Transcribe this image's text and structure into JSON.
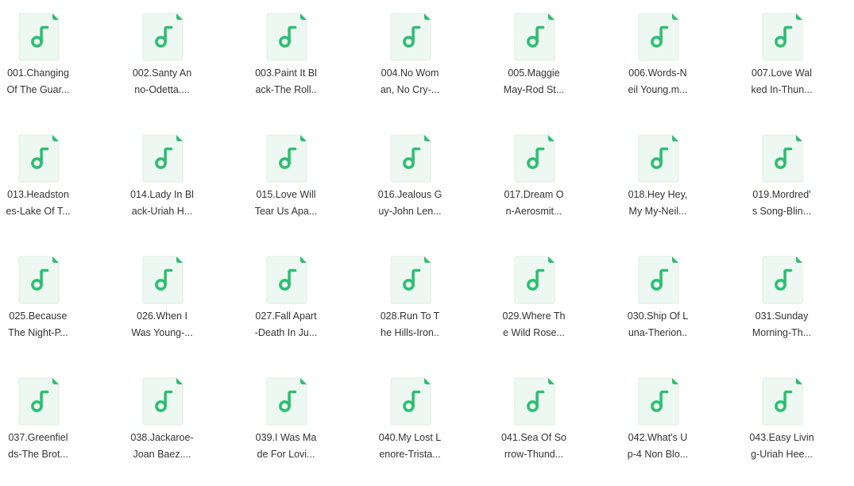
{
  "icons": {
    "file": "music-file-icon",
    "accent": "#2ebf72",
    "paper": "#eef8f2",
    "edge": "#dcece2"
  },
  "files": [
    {
      "line1": "001.Changing",
      "line2": "Of The Guar..."
    },
    {
      "line1": "002.Santy An",
      "line2": "no-Odetta...."
    },
    {
      "line1": "003.Paint It Bl",
      "line2": "ack-The Roll.."
    },
    {
      "line1": "004.No Wom",
      "line2": "an, No Cry-..."
    },
    {
      "line1": "005.Maggie",
      "line2": "May-Rod St..."
    },
    {
      "line1": "006.Words-N",
      "line2": "eil Young.m..."
    },
    {
      "line1": "007.Love Wal",
      "line2": "ked In-Thun..."
    },
    {
      "line1": "013.Headston",
      "line2": "es-Lake Of T..."
    },
    {
      "line1": "014.Lady In Bl",
      "line2": "ack-Uriah H..."
    },
    {
      "line1": "015.Love Will",
      "line2": "Tear Us Apa..."
    },
    {
      "line1": "016.Jealous G",
      "line2": "uy-John Len..."
    },
    {
      "line1": "017.Dream O",
      "line2": "n-Aerosmit..."
    },
    {
      "line1": "018.Hey Hey,",
      "line2": "My My-Neil..."
    },
    {
      "line1": "019.Mordred'",
      "line2": "s Song-Blin..."
    },
    {
      "line1": "025.Because",
      "line2": "The Night-P..."
    },
    {
      "line1": "026.When I",
      "line2": "Was Young-..."
    },
    {
      "line1": "027.Fall Apart",
      "line2": "-Death In Ju..."
    },
    {
      "line1": "028.Run To T",
      "line2": "he Hills-Iron.."
    },
    {
      "line1": "029.Where Th",
      "line2": "e Wild Rose..."
    },
    {
      "line1": "030.Ship Of L",
      "line2": "una-Therion.."
    },
    {
      "line1": "031.Sunday",
      "line2": "Morning-Th..."
    },
    {
      "line1": "037.Greenfiel",
      "line2": "ds-The Brot..."
    },
    {
      "line1": "038.Jackaroe-",
      "line2": "Joan Baez...."
    },
    {
      "line1": "039.I Was Ma",
      "line2": "de For Lovi..."
    },
    {
      "line1": "040.My Lost L",
      "line2": "enore-Trista..."
    },
    {
      "line1": "041.Sea Of So",
      "line2": "rrow-Thund..."
    },
    {
      "line1": "042.What's U",
      "line2": "p-4 Non Blo..."
    },
    {
      "line1": "043.Easy Livin",
      "line2": "g-Uriah Hee..."
    }
  ]
}
